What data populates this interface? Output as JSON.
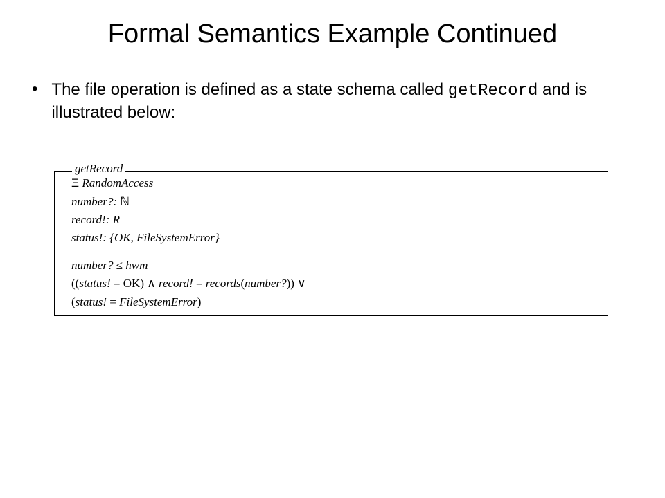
{
  "title": "Formal Semantics Example Continued",
  "bullet": {
    "pre": "The file operation is defined as a state schema called ",
    "code": "getRecord",
    "post": " and is illustrated below:"
  },
  "schema": {
    "name": "getRecord",
    "decl": {
      "xi_schema": "RandomAccess",
      "number_type": "ℕ",
      "record_type": "R",
      "status_set": "{OK, FileSystemError}",
      "number_var": "number?:",
      "record_var": "record!:",
      "status_var": "status!:"
    },
    "pred": {
      "line1_a": "number?",
      "line1_op": "≤",
      "line1_b": "hwm",
      "line2_status_ok": "status!",
      "line2_eq": " = ",
      "line2_ok": "OK",
      "line2_and": "∧",
      "line2_rec": "record!",
      "line2_recs": "records",
      "line2_num": "number?",
      "line2_or": "∨",
      "line3_status": "status!",
      "line3_err": "FileSystemError"
    }
  }
}
